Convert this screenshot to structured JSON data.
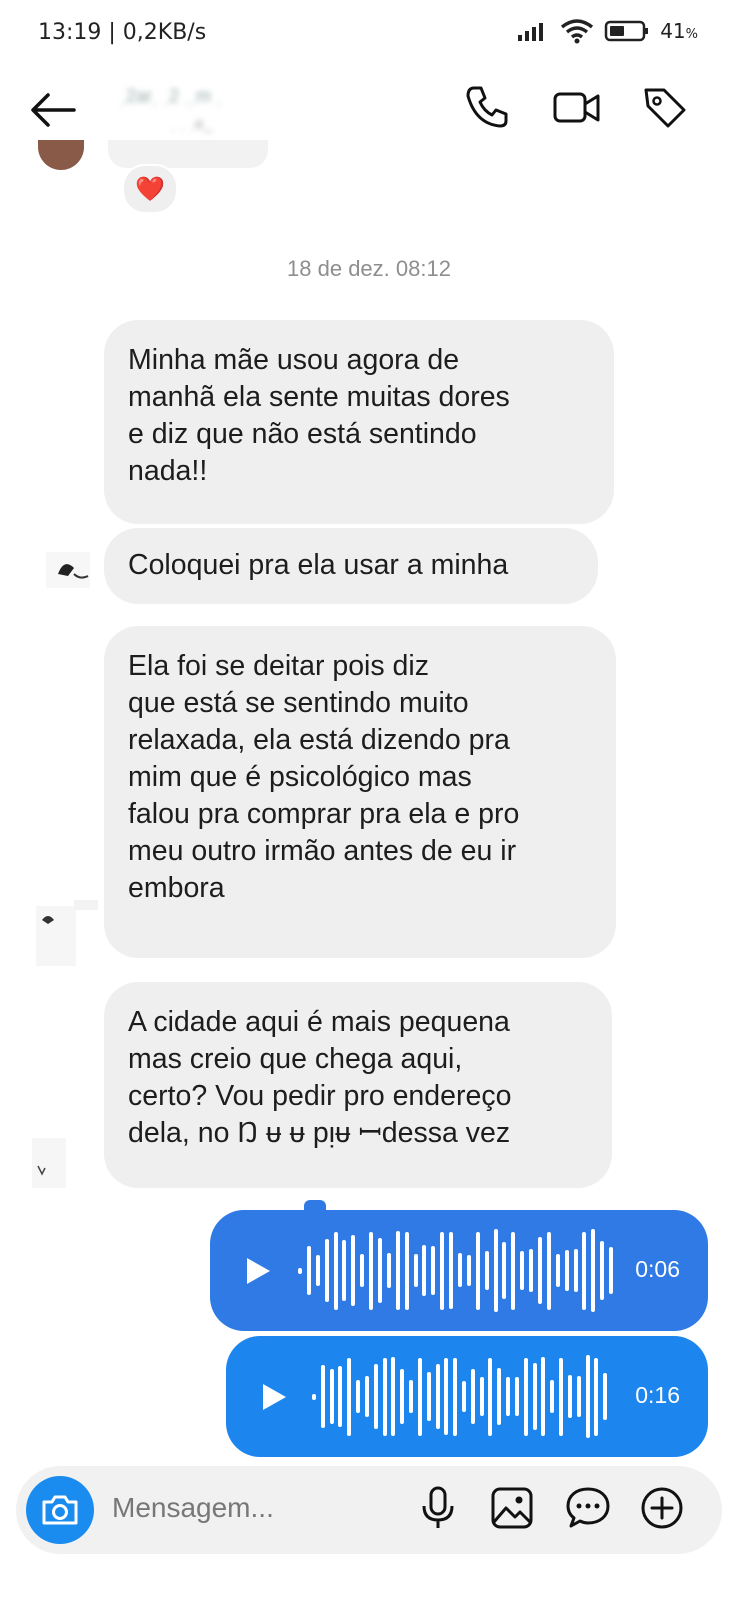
{
  "status_bar": {
    "time_speed": "13:19 | 0,2KB/s",
    "battery": "41",
    "battery_unit": "%"
  },
  "header": {
    "contact_name": "ˌ2arˌ  ˌ2   ˌˌm ˌ",
    "contact_sub": "ˌ  ˌ ˌe_"
  },
  "reaction": {
    "emoji": "❤️"
  },
  "conversation": {
    "timestamp": "18 de dez. 08:12",
    "messages": [
      {
        "text": "Minha mãe usou agora de\nmanhã ela sente muitas dores\ne diz que não está sentindo\nnada!!"
      },
      {
        "text": "Coloquei pra ela usar a minha"
      },
      {
        "text": "Ela foi se deitar pois diz\nque está se sentindo muito\nrelaxada, ela está dizendo pra\nmim que é psicológico mas\nfalou pra comprar pra ela e pro\nmeu outro irmão antes de eu ir\nembora"
      },
      {
        "text": "A cidade aqui é mais pequena\nmas creio que chega aqui,\ncerto? Vou pedir pro endereço\ndela, no Ŋ ᵾ ᵾ pᴉᵾ ꟷdessa vez"
      }
    ],
    "audio": [
      {
        "duration": "0:06",
        "color": "#2f7ae5"
      },
      {
        "duration": "0:16",
        "color": "#1d86ee"
      }
    ]
  },
  "composer": {
    "placeholder": "Mensagem..."
  },
  "colors": {
    "accent": "#1a8cf0",
    "bubble": "#efefef"
  }
}
